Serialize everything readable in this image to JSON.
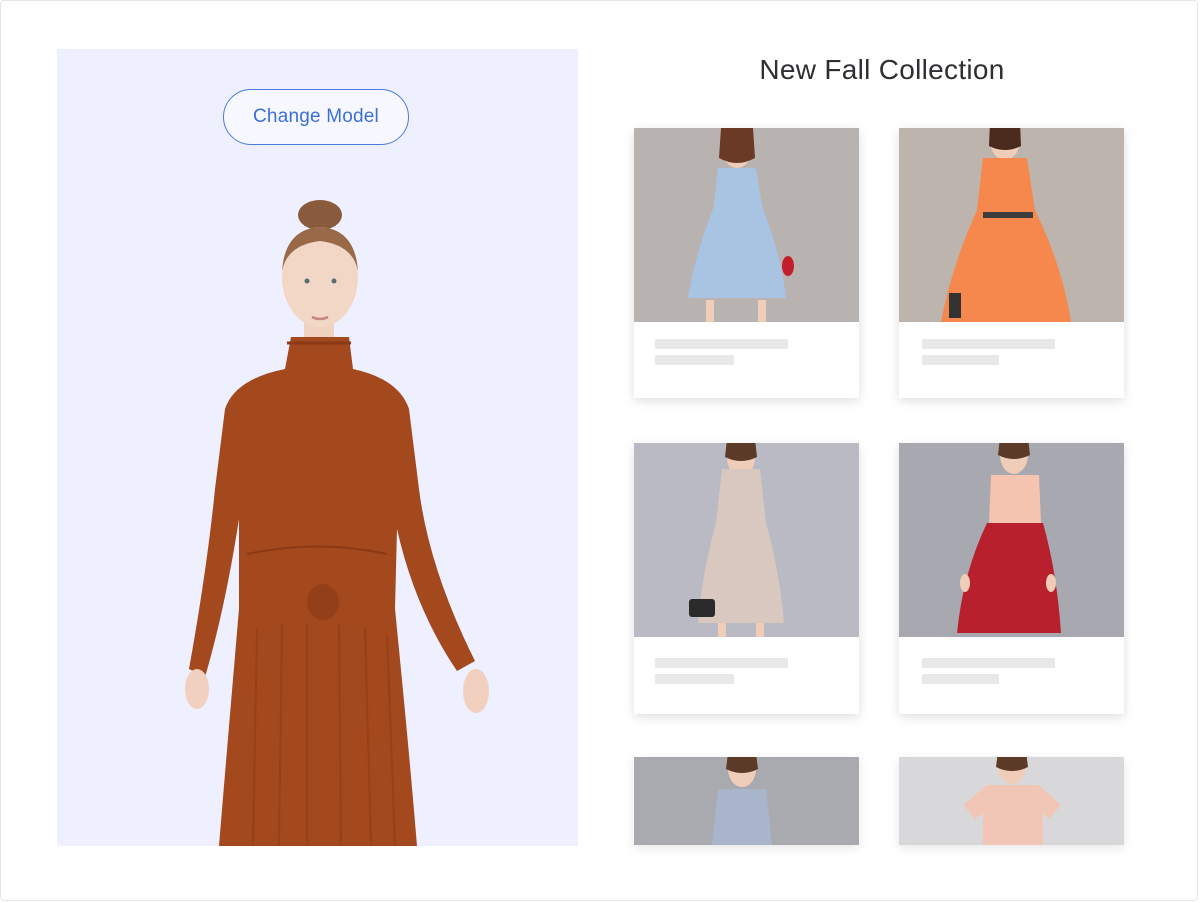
{
  "model_panel": {
    "change_model_label": "Change Model",
    "background": "#eef0ff",
    "accent": "#3b6fd8"
  },
  "collection": {
    "title": "New Fall Collection",
    "products": [
      {
        "dress_color": "#a9c4e3",
        "backdrop": "#b8b2b1"
      },
      {
        "dress_color": "#f7884d",
        "backdrop": "#bdb4ae"
      },
      {
        "dress_color": "#d9c8bf",
        "backdrop": "#b9bac4"
      },
      {
        "dress_color": "#b8202d",
        "backdrop": "#a7a8b0"
      },
      {
        "dress_color": "#a9b5cb",
        "backdrop": "#a9aab0"
      },
      {
        "dress_color": "#f2c6b6",
        "backdrop": "#d8d8da"
      }
    ]
  }
}
